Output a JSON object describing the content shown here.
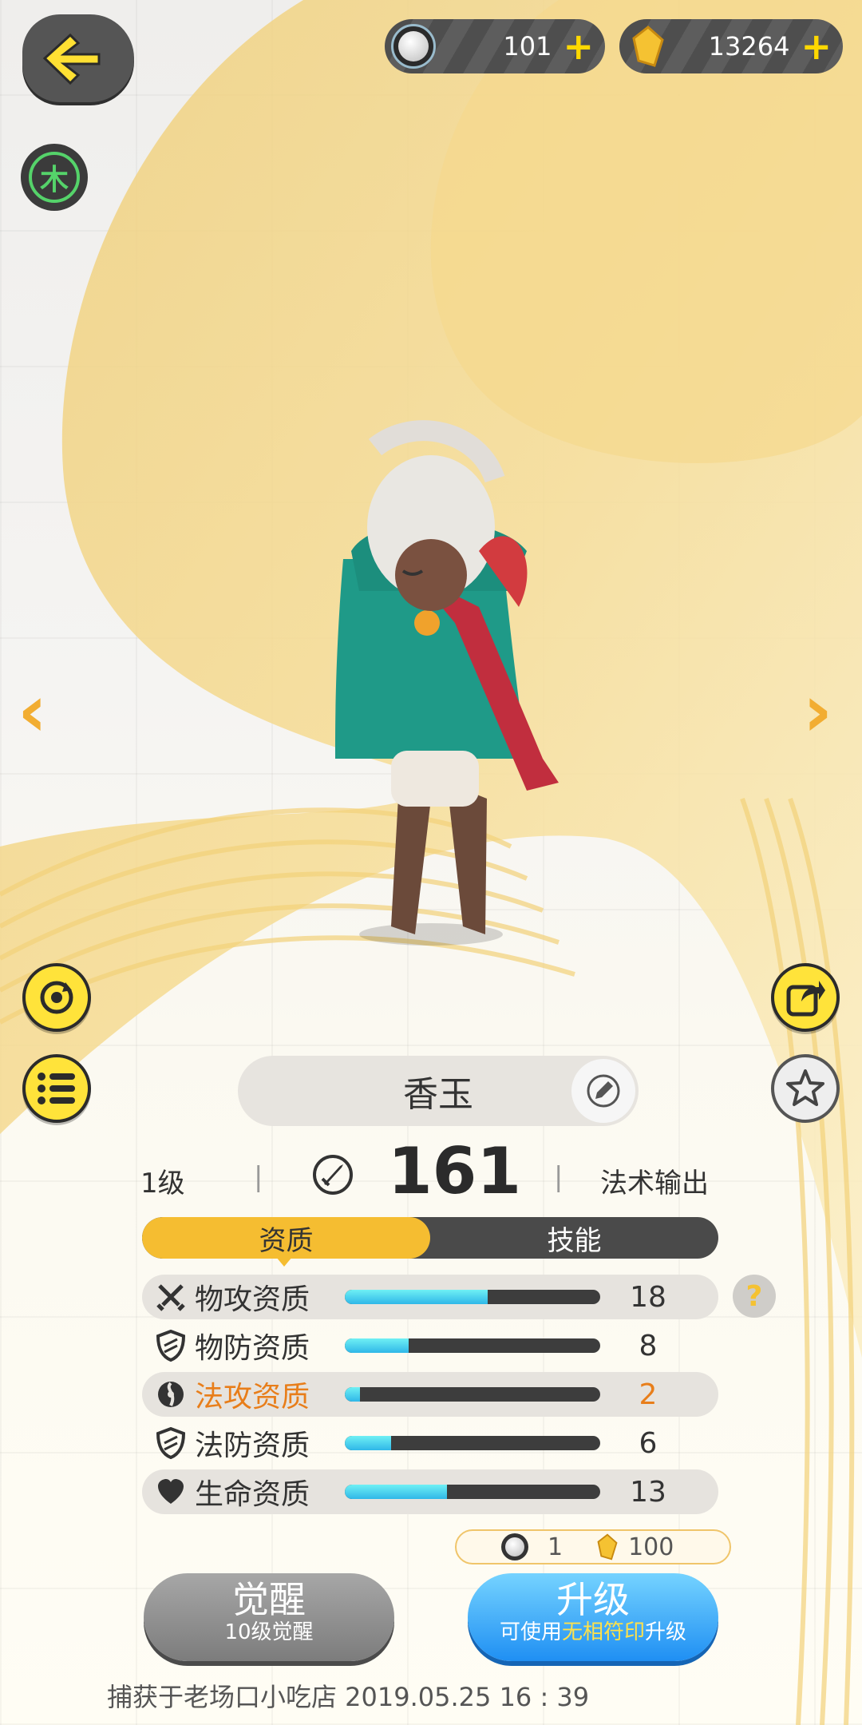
{
  "header": {
    "currency_pearl": "101",
    "currency_gold": "13264",
    "element": "木"
  },
  "pet": {
    "name": "香玉",
    "level": "1级",
    "power": "161",
    "role": "法术输出"
  },
  "tabs": [
    "资质",
    "技能"
  ],
  "aptitudes": [
    {
      "label": "物攻资质",
      "value": "18",
      "fill": 0.56,
      "icon": "swords-icon"
    },
    {
      "label": "物防资质",
      "value": "8",
      "fill": 0.25,
      "icon": "shield-icon"
    },
    {
      "label": "法攻资质",
      "value": "2",
      "fill": 0.06,
      "icon": "magic-orb-icon"
    },
    {
      "label": "法防资质",
      "value": "6",
      "fill": 0.18,
      "icon": "shield-icon"
    },
    {
      "label": "生命资质",
      "value": "13",
      "fill": 0.4,
      "icon": "heart-icon"
    }
  ],
  "cost": {
    "pearl": "1",
    "gold": "100"
  },
  "buttons": {
    "awaken": "觉醒",
    "awaken_sub": "10级觉醒",
    "upgrade": "升级",
    "upgrade_sub_1": "可使用",
    "upgrade_sub_2": "无相符印",
    "upgrade_sub_3": "升级"
  },
  "capture": "捕获于老场口小吃店  2019.05.25  16 : 39",
  "colors": {
    "accent": "#f5bd31",
    "highlight": "#e87e1a",
    "element": "#55d36a",
    "upgrade": "#1f8ff3"
  }
}
